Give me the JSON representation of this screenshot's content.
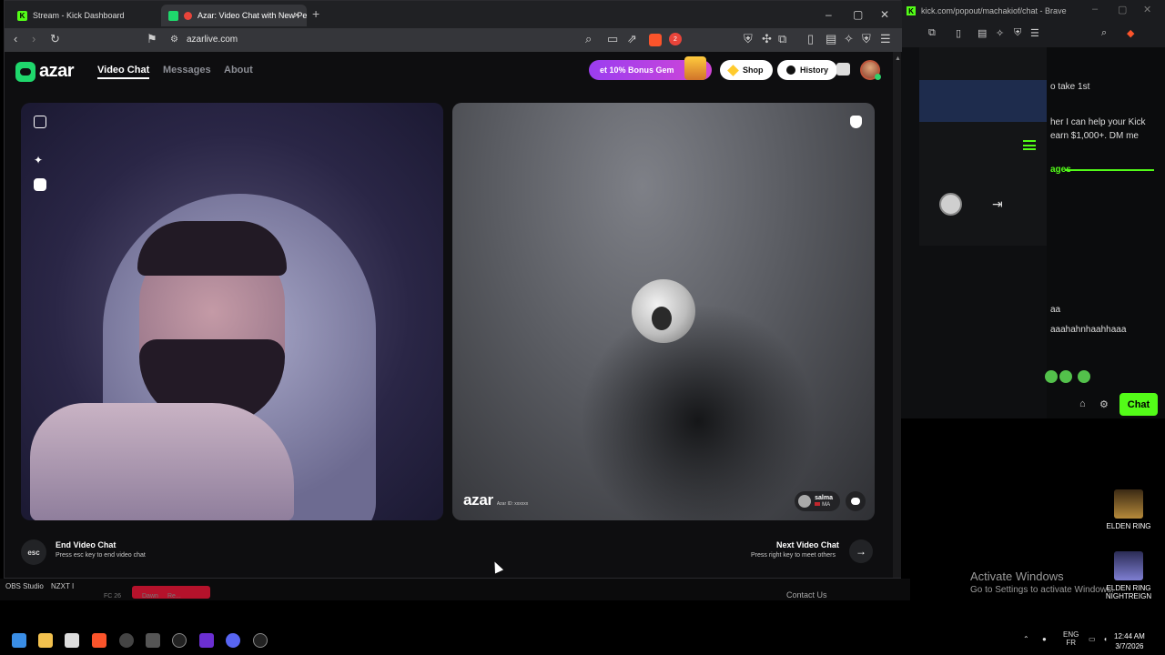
{
  "right_window": {
    "title": "kick.com/popout/machakiof/chat - Brave",
    "lines": [
      "o take 1st",
      "her I can help your Kick",
      "earn $1,000+. DM me",
      "ages",
      "aa",
      "aaahahnhaahhaaa"
    ],
    "chat_button": "Chat"
  },
  "browser": {
    "tabs": [
      {
        "title": "Stream - Kick Dashboard",
        "favicon": "kick-icon"
      },
      {
        "title": "Azar: Video Chat with New Pe",
        "favicon": "azar-icon"
      }
    ],
    "new_tab": "+",
    "url": "azarlive.com",
    "brave_badge_count": "2"
  },
  "azar": {
    "logo": "azar",
    "nav": [
      "Video Chat",
      "Messages",
      "About"
    ],
    "bonus": "et 10% Bonus Gem",
    "shop": "Shop",
    "history": "History",
    "watermark": "azar",
    "watermark_id": "Azar ID: xxxxxx",
    "peer": {
      "name": "salma",
      "country": "MA"
    },
    "end": {
      "key": "esc",
      "title": "End Video Chat",
      "subtitle": "Press esc key to end video chat"
    },
    "next": {
      "title": "Next Video Chat",
      "subtitle": "Press right key to meet others",
      "arrow": "→"
    }
  },
  "desktop": {
    "icons": [
      "ELDEN RING",
      "ELDEN RING NIGHTREIGN"
    ],
    "activate_title": "Activate Windows",
    "activate_sub": "Go to Settings to activate Windows.",
    "taskbar_labels": [
      "OBS Studio",
      "NZXT I"
    ],
    "behind_text": [
      "FC 26",
      "Dawn",
      "Re..."
    ],
    "contact": "Contact Us"
  },
  "tray": {
    "lang1": "ENG",
    "lang2": "FR",
    "time": "12:44 AM",
    "date": "3/7/2026"
  }
}
